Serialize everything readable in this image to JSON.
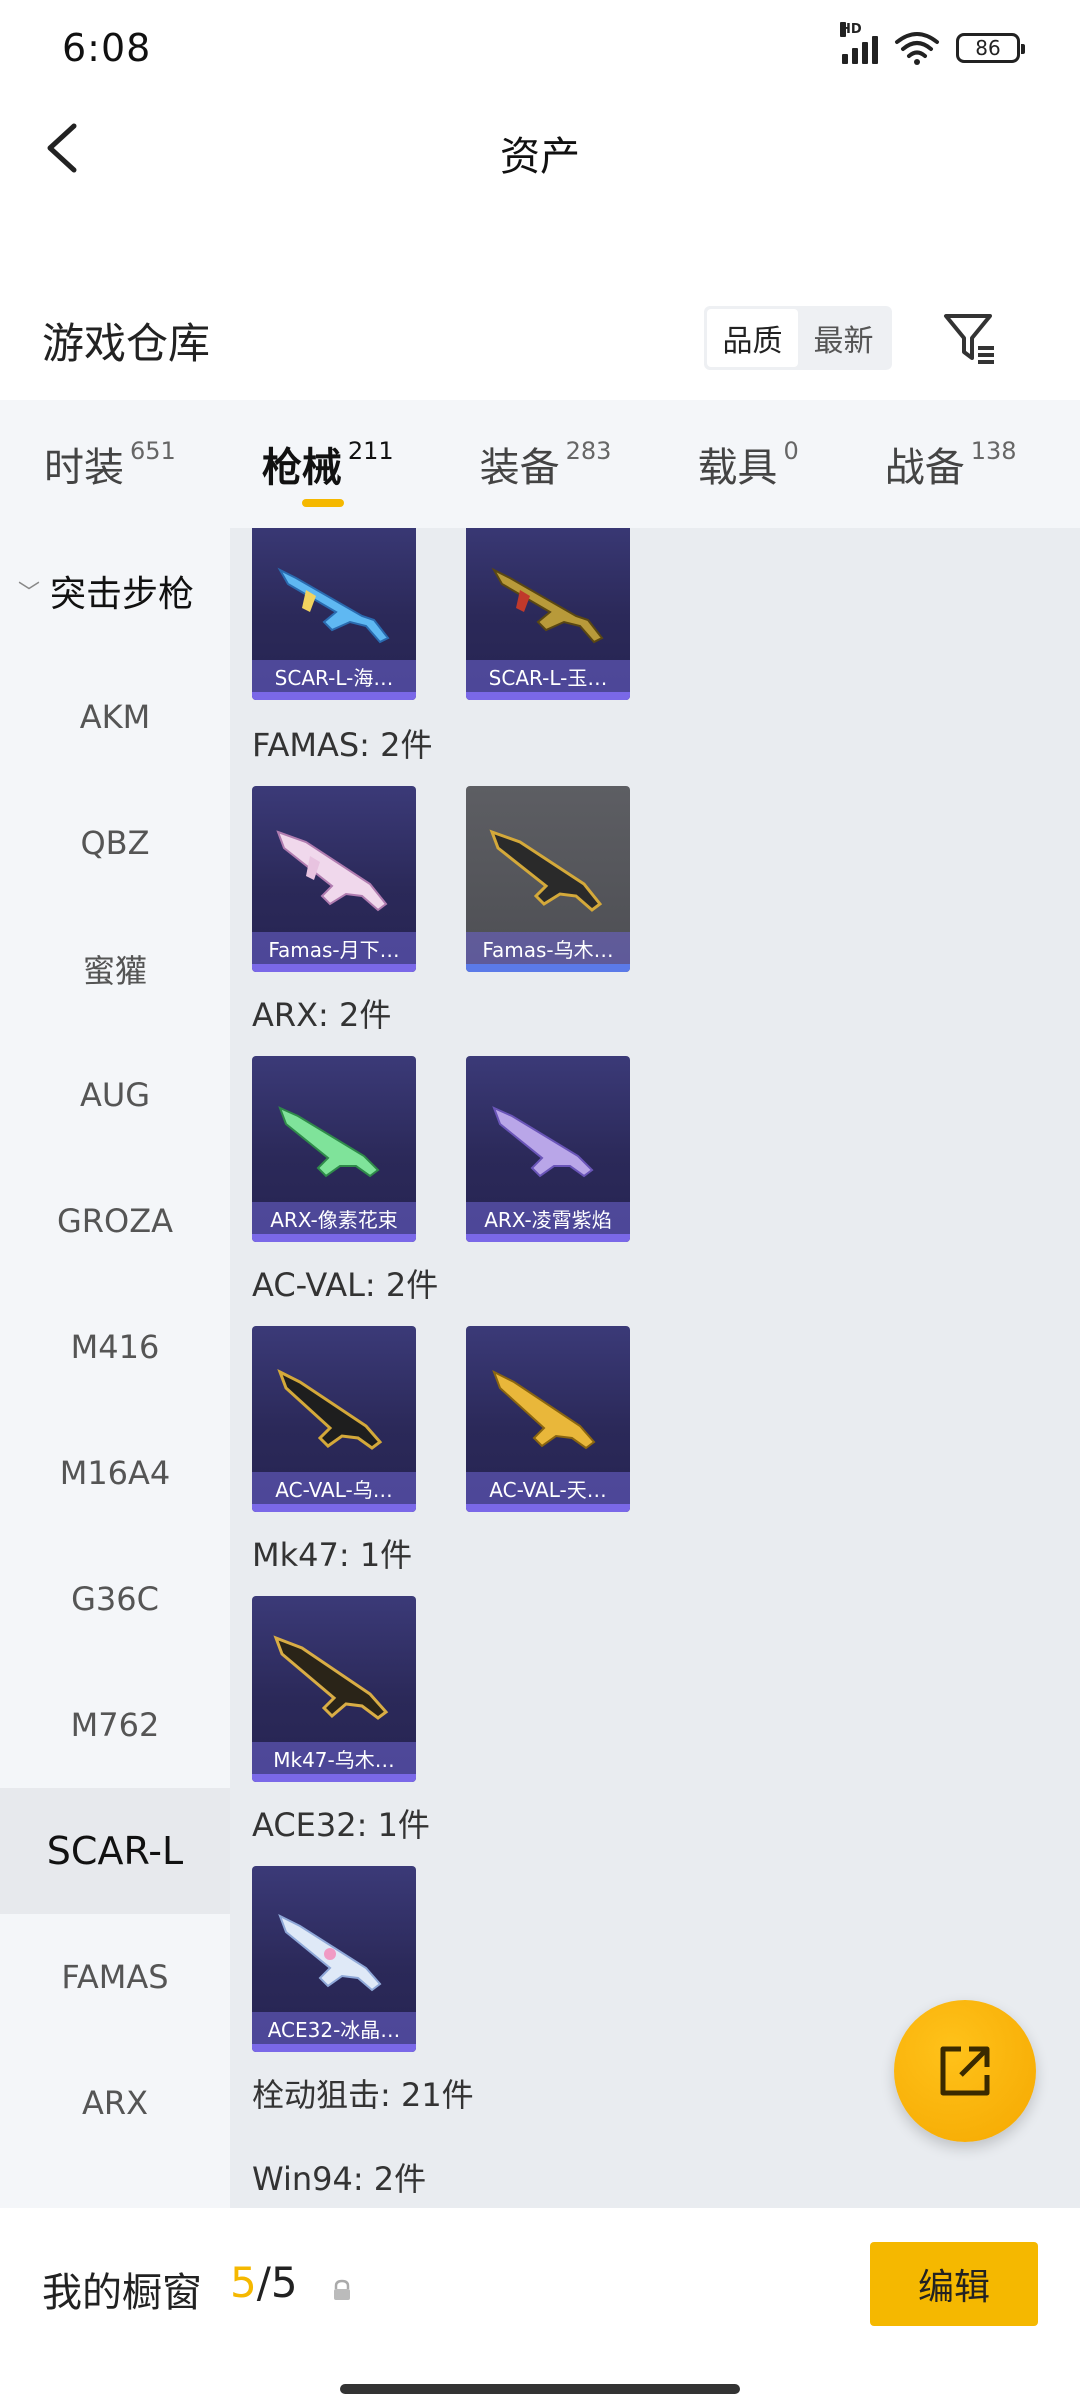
{
  "status_bar": {
    "time": "6:08",
    "network": "HD",
    "battery": "86"
  },
  "header": {
    "title": "资产"
  },
  "warehouse": {
    "title": "游戏仓库",
    "sort_options": [
      "品质",
      "最新"
    ],
    "active_sort": "品质"
  },
  "tabs": [
    {
      "label": "时装",
      "count": "651"
    },
    {
      "label": "枪械",
      "count": "211"
    },
    {
      "label": "装备",
      "count": "283"
    },
    {
      "label": "载具",
      "count": "0"
    },
    {
      "label": "战备",
      "count": "138"
    }
  ],
  "active_tab": "枪械",
  "sidebar": {
    "group": "突击步枪",
    "items": [
      "AKM",
      "QBZ",
      "蜜獾",
      "AUG",
      "GROZA",
      "M416",
      "M16A4",
      "G36C",
      "M762",
      "SCAR-L",
      "FAMAS",
      "ARX"
    ],
    "active": "SCAR-L"
  },
  "content": {
    "top_cards": [
      "SCAR-L-海…",
      "SCAR-L-玉…"
    ],
    "groups": [
      {
        "label": "FAMAS: 2件",
        "items": [
          "Famas-月下…",
          "Famas-乌木…"
        ]
      },
      {
        "label": "ARX: 2件",
        "items": [
          "ARX-像素花束",
          "ARX-凌霄紫焰"
        ]
      },
      {
        "label": "AC-VAL: 2件",
        "items": [
          "AC-VAL-乌…",
          "AC-VAL-天…"
        ]
      },
      {
        "label": "Mk47: 1件",
        "items": [
          "Mk47-乌木…"
        ]
      },
      {
        "label": "ACE32: 1件",
        "items": [
          "ACE32-冰晶…"
        ]
      },
      {
        "label": "栓动狙击: 21件",
        "items": []
      },
      {
        "label": "Win94: 2件",
        "items": []
      }
    ]
  },
  "bottom_bar": {
    "showcase_label": "我的橱窗",
    "showcase_current": "5",
    "showcase_sep": "/",
    "showcase_total": "5",
    "edit_label": "编辑"
  },
  "colors": {
    "accent": "#f5b800",
    "card_bg": "#2b2959",
    "sidebar_bg": "#f4f6f9",
    "content_bg": "#e9ecf0"
  }
}
